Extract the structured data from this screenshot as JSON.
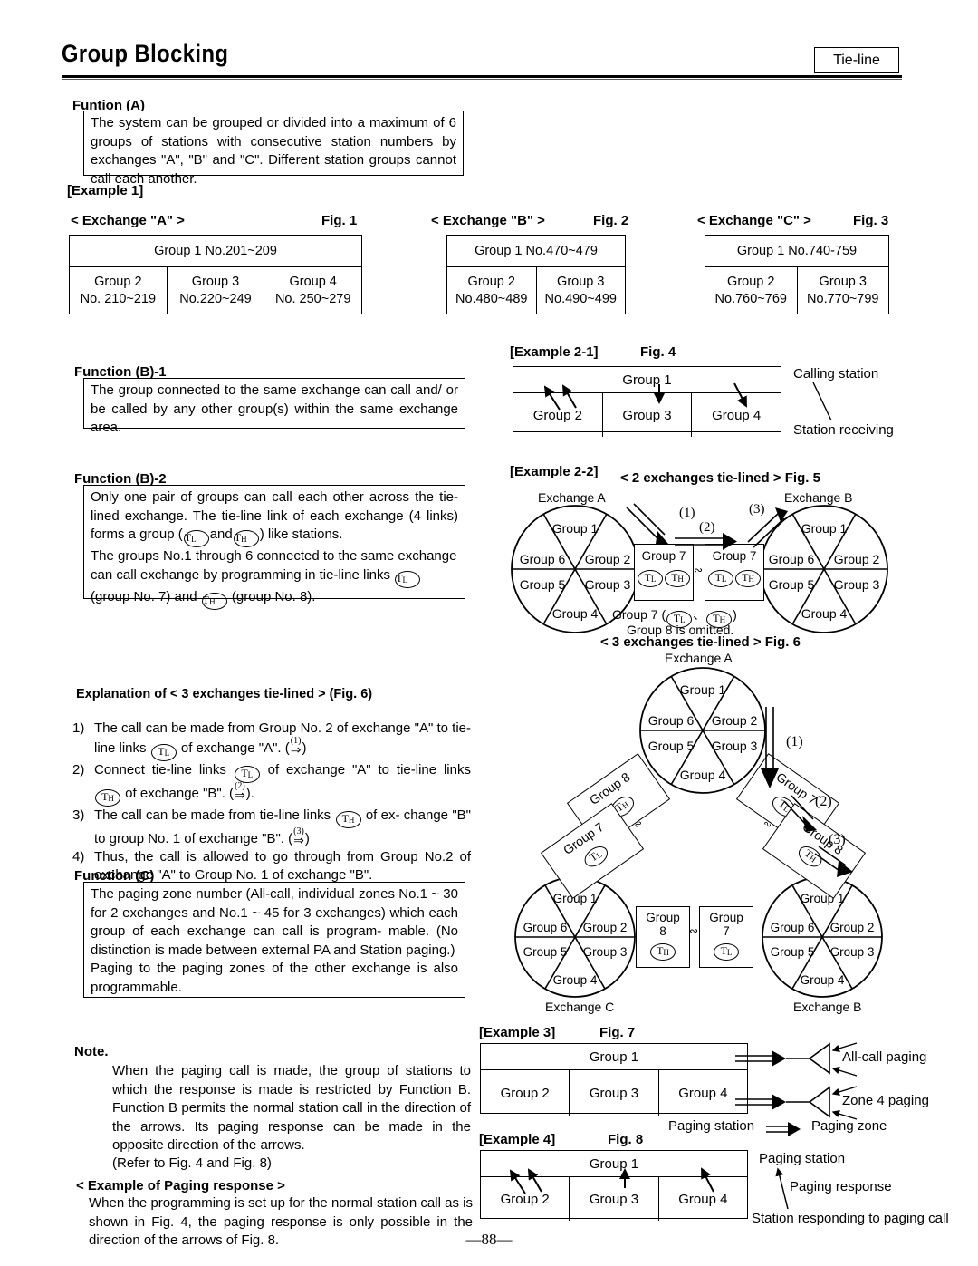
{
  "header": {
    "title": "Group Blocking",
    "badge": "Tie-line"
  },
  "function_a": {
    "heading": "Funtion (A)",
    "body": "The system can be grouped or divided into a maximum of 6 groups of stations with consecutive station numbers by exchanges \"A\", \"B\" and \"C\". Different station groups cannot call each another."
  },
  "example1": {
    "label": "[Example 1]",
    "tables": [
      {
        "caption": "< Exchange \"A\" >",
        "fig": "Fig. 1",
        "header": "Group 1   No.201~209",
        "cells": [
          {
            "group": "Group 2",
            "range": "No. 210~219"
          },
          {
            "group": "Group 3",
            "range": "No.220~249"
          },
          {
            "group": "Group 4",
            "range": "No. 250~279"
          }
        ]
      },
      {
        "caption": "< Exchange \"B\" >",
        "fig": "Fig. 2",
        "header": "Group 1  No.470~479",
        "cells": [
          {
            "group": "Group 2",
            "range": "No.480~489"
          },
          {
            "group": "Group 3",
            "range": "No.490~499"
          }
        ]
      },
      {
        "caption": "< Exchange \"C\" >",
        "fig": "Fig. 3",
        "header": "Group 1  No.740-759",
        "cells": [
          {
            "group": "Group 2",
            "range": "No.760~769"
          },
          {
            "group": "Group 3",
            "range": "No.770~799"
          }
        ]
      }
    ]
  },
  "function_b1": {
    "heading": "Function (B)-1",
    "body": "The group connected to the same exchange can call and/ or be called by any other group(s) within the same exchange area."
  },
  "function_b2": {
    "heading": "Function (B)-2",
    "line1_a": "Only one pair of groups can call each other across the tie-lined exchange. The tie-line link of each exchange (4 links) forms a group (",
    "tl": "T",
    "tl_sub": "L",
    "th": "T",
    "th_sub": "H",
    "line1_b": "and",
    "line1_c": ") like stations.",
    "line2_a": "The groups No.1 through 6 connected to the same exchange can call exchange by programming in tie-line links",
    "line2_b": "(group No. 7) and",
    "line2_c": "(group No. 8)."
  },
  "explanation": {
    "heading": "Explanation of < 3 exchanges tie-lined >  (Fig. 6)",
    "items": [
      {
        "num": "1)",
        "a": "The call can be made from Group No. 2 of exchange \"A\" to tie-line links",
        "b": "of exchange  \"A\". (",
        "arrow": "(1)",
        "c": ")"
      },
      {
        "num": "2)",
        "a": "Connect tie-line links",
        "b": "of exchange \"A\" to tie-line links",
        "arrow": "(2)",
        "c": "of exchange   \"B\". (",
        "d": ")."
      },
      {
        "num": "3)",
        "a": "The call can be made from tie-line links",
        "b": "of ex- change \"B\" to group No. 1 of exchange  \"B\". (",
        "arrow": "(3)",
        "c": ")"
      },
      {
        "num": "4)",
        "a": "Thus, the call is allowed to go through from Group No.2 of exchange \"A\" to Group No. 1 of exchange \"B\"."
      }
    ]
  },
  "function_c": {
    "heading": "Function (C)",
    "para1": "The paging zone number (All-call, individual zones No.1 ~ 30 for 2 exchanges and No.1 ~ 45 for 3 exchanges) which each group of each exchange can call is program- mable. (No distinction is made between external PA and Station paging.)",
    "para2": "Paging to the paging zones of the other exchange is also programmable."
  },
  "note": {
    "heading": "Note.",
    "body": "When the paging call is made, the group of stations to which the response is made is restricted by Function B. Function B permits the normal station call in the direction of the arrows. Its paging response can be made in the opposite direction of the arrows.",
    "refer": "(Refer to Fig. 4 and Fig. 8)"
  },
  "paging_response_example": {
    "heading": "< Example of Paging response >",
    "body": "When the programming is set up for the normal station call as is shown in Fig. 4, the paging response is only possible in the direction of the arrows of Fig. 8."
  },
  "example2_1": {
    "label": "[Example 2-1]",
    "fig": "Fig. 4",
    "table": {
      "top": "Group 1",
      "bottom": [
        "Group 2",
        "Group 3",
        "Group 4"
      ]
    },
    "annotation_top": "Calling station",
    "annotation_bottom": "Station receiving"
  },
  "example2_2": {
    "label": "[Example 2-2]",
    "title": "< 2 exchanges tie-lined >  Fig. 5",
    "exchange_left": "Exchange A",
    "exchange_right": "Exchange B",
    "wheel_groups": [
      "Group 1",
      "Group 2",
      "Group 3",
      "Group 4",
      "Group 5",
      "Group 6"
    ],
    "link_box_left": {
      "title": "Group 7",
      "tl": "T",
      "tl_sub": "L",
      "th": "T",
      "th_sub": "H"
    },
    "link_box_right": {
      "title": "Group 7",
      "tl": "T",
      "tl_sub": "L",
      "th": "T",
      "th_sub": "H"
    },
    "arrow_labels": [
      "(1)",
      "(2)",
      "(3)"
    ],
    "footnote1": "Group 7 (",
    "footnote1b": "、",
    "footnote1c": ")",
    "footnote2": "Group 8 is omitted."
  },
  "fig6": {
    "title": "< 3 exchanges tie-lined > Fig. 6",
    "exchange_a": "Exchange A",
    "exchange_b": "Exchange B",
    "exchange_c": "Exchange C",
    "wheel_groups": [
      "Group 1",
      "Group 2",
      "Group 3",
      "Group 4",
      "Group 5",
      "Group 6"
    ],
    "tilted_boxes": [
      {
        "title": "Group 8",
        "badge": "T",
        "badge_sub": "H"
      },
      {
        "title": "Group 7",
        "badge": "T",
        "badge_sub": "L"
      },
      {
        "title": "Group 7",
        "badge": "T",
        "badge_sub": "L"
      },
      {
        "title": "Group 8",
        "badge": "T",
        "badge_sub": "H"
      }
    ],
    "bottom_boxes": [
      {
        "title": "Group",
        "num": "8",
        "badge": "T",
        "badge_sub": "H"
      },
      {
        "title": "Group",
        "num": "7",
        "badge": "T",
        "badge_sub": "L"
      }
    ],
    "arrow_labels": [
      "(1)",
      "(2)",
      "(3)"
    ]
  },
  "example3": {
    "label": "[Example 3]",
    "fig": "Fig. 7",
    "table": {
      "top": "Group 1",
      "bottom": [
        "Group 2",
        "Group 3",
        "Group 4"
      ]
    },
    "annotation_allcall": "All-call paging",
    "annotation_zone4": "Zone 4 paging",
    "legend_from": "Paging station",
    "legend_to": "Paging zone"
  },
  "example4": {
    "label": "[Example 4]",
    "fig": "Fig. 8",
    "table": {
      "top": "Group 1",
      "bottom": [
        "Group 2",
        "Group 3",
        "Group 4"
      ]
    },
    "annotation_station": "Paging station",
    "annotation_response": "Paging response",
    "annotation_bottom": "Station responding to paging call"
  },
  "footer": {
    "page": "—88—"
  }
}
